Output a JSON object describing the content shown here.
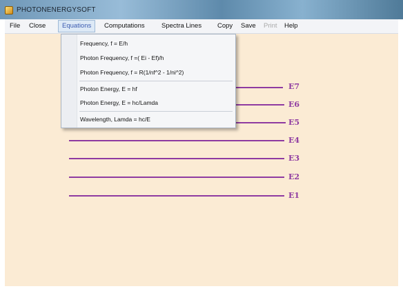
{
  "window": {
    "title": "PHOTONENERGYSOFT"
  },
  "menu": [
    {
      "id": "file",
      "label": "File",
      "state": "normal"
    },
    {
      "id": "close",
      "label": "Close",
      "state": "normal"
    },
    {
      "id": "equations",
      "label": "Equations",
      "state": "active"
    },
    {
      "id": "computations",
      "label": "Computations",
      "state": "normal"
    },
    {
      "id": "spectra-lines",
      "label": "Spectra Lines",
      "state": "normal"
    },
    {
      "id": "copy",
      "label": "Copy",
      "state": "normal"
    },
    {
      "id": "save",
      "label": "Save",
      "state": "normal"
    },
    {
      "id": "print",
      "label": "Print",
      "state": "disabled"
    },
    {
      "id": "help",
      "label": "Help",
      "state": "normal"
    }
  ],
  "equations_menu": {
    "groups": [
      [
        "Frequency, f = E/h",
        "Photon Frequency, f =( Ei - Ef)/h",
        "Photon Frequency, f = R(1/nf^2 - 1/ni^2)"
      ],
      [
        "Photon Energy, E = hf",
        "Photon Energy, E = hc/Lamda"
      ],
      [
        "Wavelength, Lamda = hc/E"
      ]
    ]
  },
  "energy_levels": [
    "E7",
    "E6",
    "E5",
    "E4",
    "E3",
    "E2",
    "E1"
  ],
  "colors": {
    "background": "#fbebd4",
    "level_line": "#8e3aa1",
    "active_menu_text": "#3b5bb0"
  }
}
